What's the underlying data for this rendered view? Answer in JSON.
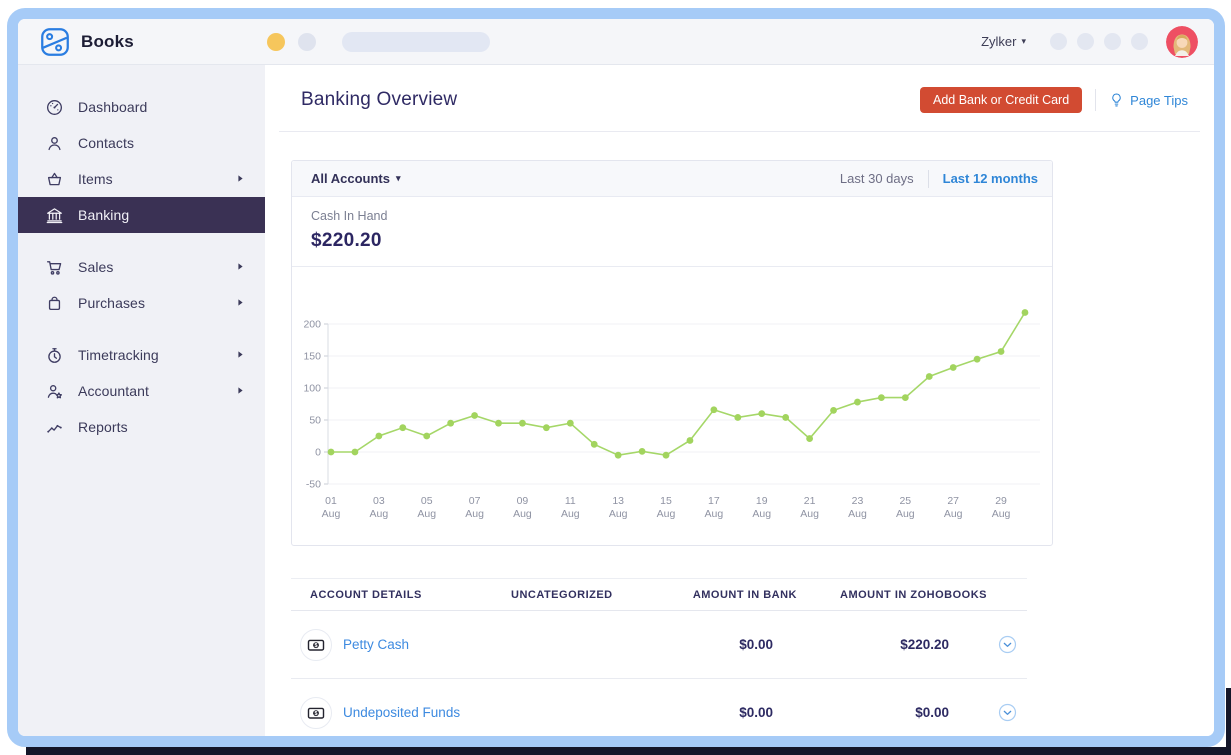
{
  "topbar": {
    "logo_text": "Books",
    "org_name": "Zylker",
    "caret": "▾"
  },
  "sidebar": {
    "groups": [
      {
        "items": [
          {
            "label": "Dashboard",
            "icon": "dashboard-icon",
            "active": false,
            "submenu": false
          },
          {
            "label": "Contacts",
            "icon": "contacts-icon",
            "active": false,
            "submenu": false
          },
          {
            "label": "Items",
            "icon": "items-icon",
            "active": false,
            "submenu": true
          },
          {
            "label": "Banking",
            "icon": "banking-icon",
            "active": true,
            "submenu": false
          }
        ]
      },
      {
        "items": [
          {
            "label": "Sales",
            "icon": "sales-icon",
            "active": false,
            "submenu": true
          },
          {
            "label": "Purchases",
            "icon": "purchases-icon",
            "active": false,
            "submenu": true
          }
        ]
      },
      {
        "items": [
          {
            "label": "Timetracking",
            "icon": "timetracking-icon",
            "active": false,
            "submenu": true
          },
          {
            "label": "Accountant",
            "icon": "accountant-icon",
            "active": false,
            "submenu": true
          },
          {
            "label": "Reports",
            "icon": "reports-icon",
            "active": false,
            "submenu": false
          }
        ]
      }
    ]
  },
  "page": {
    "title": "Banking Overview",
    "add_button": "Add Bank or Credit Card",
    "page_tips": "Page Tips"
  },
  "filters": {
    "account_selector": "All Accounts",
    "range_30": "Last 30 days",
    "range_12": "Last 12 months"
  },
  "summary": {
    "label": "Cash In Hand",
    "value": "$220.20"
  },
  "chart_data": {
    "type": "line",
    "series_name": "Cash In Hand",
    "x": [
      "01 Aug",
      "02 Aug",
      "03 Aug",
      "04 Aug",
      "05 Aug",
      "06 Aug",
      "07 Aug",
      "08 Aug",
      "09 Aug",
      "10 Aug",
      "11 Aug",
      "12 Aug",
      "13 Aug",
      "14 Aug",
      "15 Aug",
      "16 Aug",
      "17 Aug",
      "18 Aug",
      "19 Aug",
      "20 Aug",
      "21 Aug",
      "22 Aug",
      "23 Aug",
      "24 Aug",
      "25 Aug",
      "26 Aug",
      "27 Aug",
      "28 Aug",
      "29 Aug",
      "30 Aug"
    ],
    "values": [
      0,
      0,
      25,
      38,
      25,
      45,
      57,
      45,
      45,
      38,
      45,
      12,
      -5,
      1,
      -5,
      18,
      66,
      54,
      60,
      54,
      21,
      65,
      78,
      85,
      85,
      118,
      132,
      145,
      157,
      218
    ],
    "y_ticks": [
      -50,
      0,
      50,
      100,
      150,
      200
    ],
    "ylim": [
      -50,
      230
    ],
    "x_tick_every": 2,
    "grid": true,
    "legend": "none",
    "line_color": "#a5d768",
    "marker_color": "#a2d45e"
  },
  "table": {
    "columns": [
      "ACCOUNT DETAILS",
      "UNCATEGORIZED",
      "AMOUNT IN BANK",
      "AMOUNT IN ZOHOBOOKS"
    ],
    "rows": [
      {
        "icon": "cash-icon",
        "name": "Petty Cash",
        "uncategorized": "",
        "amount_in_bank": "$0.00",
        "amount_in_zohobooks": "$220.20"
      },
      {
        "icon": "cash-icon",
        "name": "Undeposited Funds",
        "uncategorized": "",
        "amount_in_bank": "$0.00",
        "amount_in_zohobooks": "$0.00"
      }
    ]
  },
  "colors": {
    "frame_blue": "#a6cbf7",
    "accent_red": "#d24b32",
    "link_blue": "#3d8ae0",
    "active_blue": "#2f86d7",
    "chart_green": "#a5d768",
    "sidebar_active_bg": "#3a3154",
    "heading_navy": "#2f2a64"
  }
}
